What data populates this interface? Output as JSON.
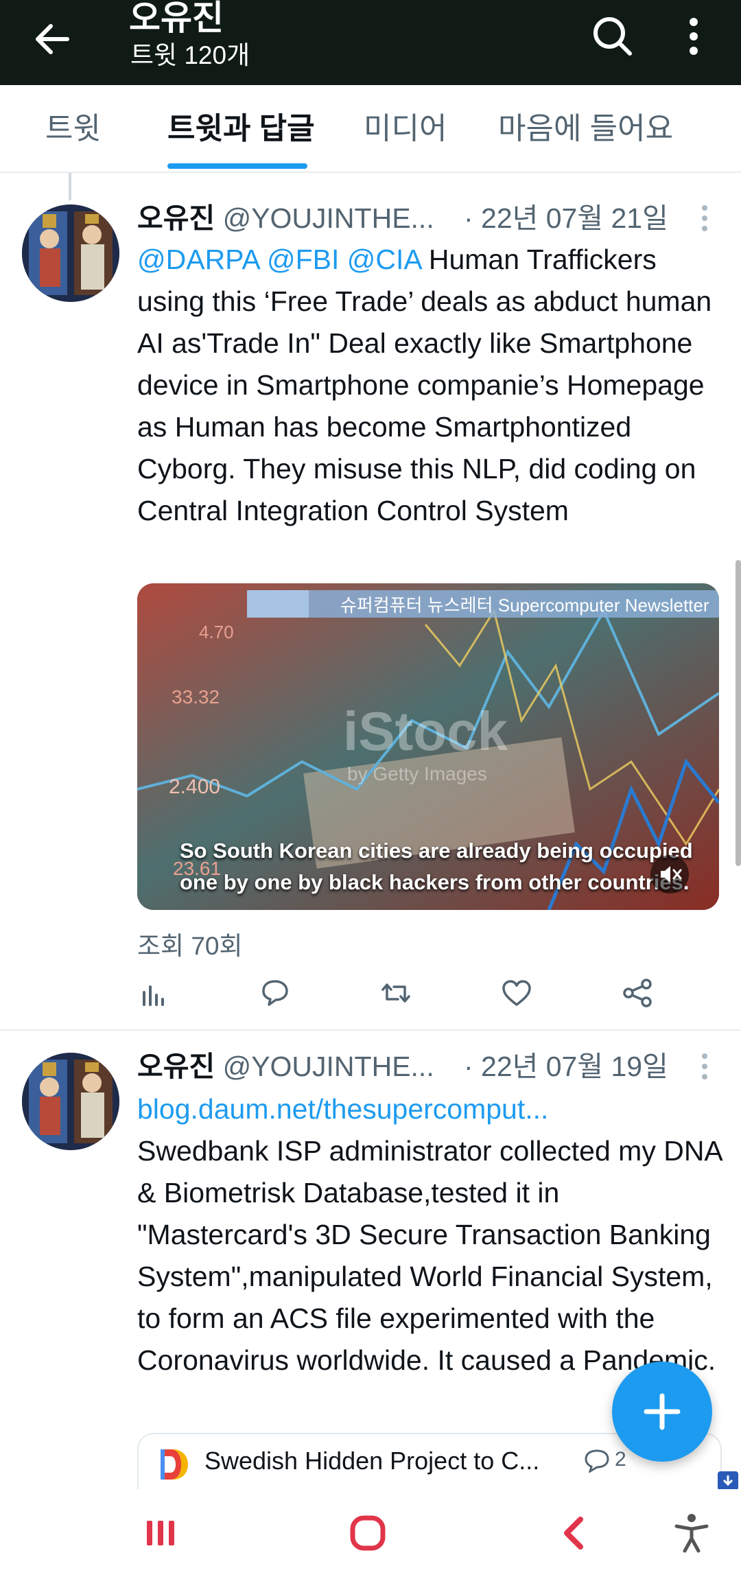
{
  "header": {
    "title": "오유진",
    "subtitle": "트윗 120개"
  },
  "tabs": [
    {
      "label": "트윗",
      "active": false
    },
    {
      "label": "트윗과 답글",
      "active": true
    },
    {
      "label": "미디어",
      "active": false
    },
    {
      "label": "마음에 들어요",
      "active": false
    }
  ],
  "tweets": [
    {
      "name": "오유진",
      "handle": "@YOUJINTHE...",
      "date": "· 22년 07월 21일",
      "mentions": "@DARPA @FBI @CIA",
      "text": " Human Traffickers using this ‘Free Trade’ deals as abduct human AI as'Trade In\" Deal exactly like Smartphone device in Smartphone companie’s Homepage as Human has become Smartphontized Cyborg. They misuse this NLP, did coding on Central Integration Control System",
      "media": {
        "banner": "슈퍼컴퓨터 뉴스레터 Supercomputer Newsletter",
        "watermark": "iStock",
        "watermark_sub": "by Getty Images",
        "numbers": [
          "4.70",
          "33.32",
          "2.400",
          "23.61"
        ],
        "caption_line1": "So South Korean cities are already being occupied",
        "caption_line2": "one by one by black hackers from other countries."
      },
      "views": "조회 70회"
    },
    {
      "name": "오유진",
      "handle": "@YOUJINTHE...",
      "date": "· 22년 07월 19일",
      "link": "blog.daum.net/thesupercomput...",
      "text": "Swedbank ISP administrator collected my DNA & Biometrisk Database,tested it in \"Mastercard's 3D Secure Transaction Banking System\",manipulated World Financial System, to form an ACS file experimented with the Coronavirus worldwide. It caused a Pandemic.",
      "card_title": "Swedish Hidden Project to C...",
      "card_count": "2"
    }
  ],
  "colors": {
    "accent": "#1d9bf0",
    "header_bg": "#0f1b14",
    "secondary_text": "#536471"
  },
  "icons": {
    "back": "arrow-left-icon",
    "search": "search-icon",
    "more": "more-vertical-icon",
    "mute": "volume-mute-icon",
    "fab": "plus-icon"
  }
}
